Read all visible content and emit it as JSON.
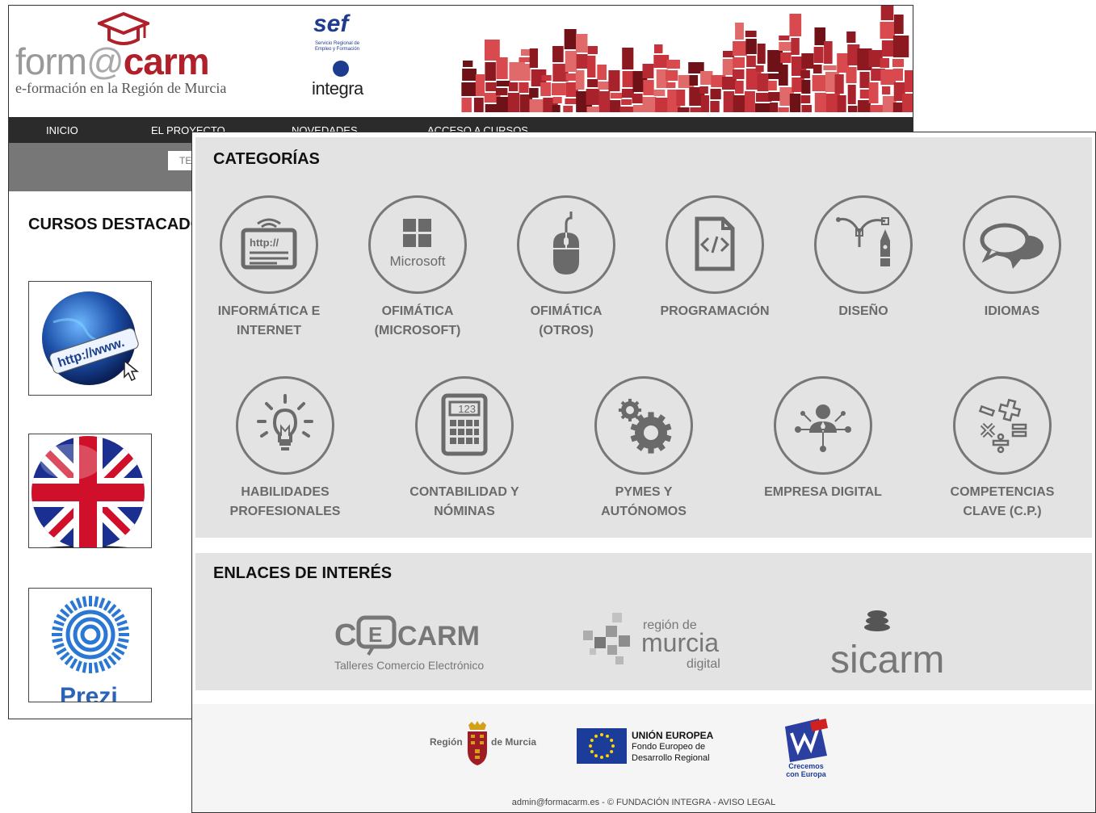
{
  "header": {
    "logo_form": "form",
    "logo_at": "@",
    "logo_carm": "carm",
    "logo_tagline": "e-formación en la Región de Murcia",
    "sef_logo": "sef",
    "sef_text": "Servicio Regional de Empleo y Formación",
    "integra_logo": "integra"
  },
  "nav": {
    "items": [
      "INICIO",
      "EL PROYECTO",
      "NOVEDADES",
      "ACCESO A CURSOS"
    ]
  },
  "search": {
    "placeholder": "TE"
  },
  "destacados": {
    "title": "CURSOS DESTACADOS",
    "thumbs": [
      {
        "icon": "globe-http-icon",
        "text": "http://www."
      },
      {
        "icon": "uk-flag-icon"
      },
      {
        "icon": "prezi-logo-icon",
        "text": "Prezi"
      }
    ]
  },
  "categorias": {
    "title": "CATEGORÍAS",
    "items": [
      {
        "label1": "INFORMÁTICA E",
        "label2": "INTERNET",
        "icon": "browser-http-icon"
      },
      {
        "label1": "OFIMÁTICA",
        "label2": "(MICROSOFT)",
        "icon": "microsoft-icon",
        "icon_text": "Microsoft"
      },
      {
        "label1": "OFIMÁTICA",
        "label2": "(OTROS)",
        "icon": "mouse-icon"
      },
      {
        "label1": "PROGRAMACIÓN",
        "label2": "",
        "icon": "code-file-icon"
      },
      {
        "label1": "DISEÑO",
        "label2": "",
        "icon": "pen-tool-icon"
      },
      {
        "label1": "IDIOMAS",
        "label2": "",
        "icon": "speech-bubbles-icon"
      },
      {
        "label1": "HABILIDADES",
        "label2": "PROFESIONALES",
        "icon": "lightbulb-icon"
      },
      {
        "label1": "CONTABILIDAD Y",
        "label2": "NÓMINAS",
        "icon": "calculator-icon",
        "icon_text": "123"
      },
      {
        "label1": "PYMES Y",
        "label2": "AUTÓNOMOS",
        "icon": "gears-icon"
      },
      {
        "label1": "EMPRESA DIGITAL",
        "label2": "",
        "icon": "network-person-icon"
      },
      {
        "label1": "COMPETENCIAS",
        "label2": "CLAVE (C.P.)",
        "icon": "math-symbols-icon"
      }
    ]
  },
  "enlaces": {
    "title": "ENLACES DE INTERÉS",
    "cecarm": {
      "main": "CARM",
      "sub": "Talleres Comercio Electrónico"
    },
    "murcia_digital": {
      "line1": "región de",
      "line2": "murcia",
      "line3": "digital"
    },
    "sicarm": "sicarm"
  },
  "footer": {
    "region_left": "Región",
    "region_right": "de Murcia",
    "ue_title": "UNIÓN EUROPEA",
    "ue_sub1": "Fondo Europeo de",
    "ue_sub2": "Desarrollo Regional",
    "crecemos1": "Crecemos",
    "crecemos2": "con Europa",
    "copyright": "admin@formacarm.es - © FUNDACIÓN INTEGRA - AVISO LEGAL"
  },
  "colors": {
    "brand_red": "#b0202a",
    "nav_bg": "#2b2b2b",
    "panel_bg": "#e3e3e3",
    "icon_gray": "#6a6a6a",
    "sef_blue": "#1d3c8f"
  }
}
